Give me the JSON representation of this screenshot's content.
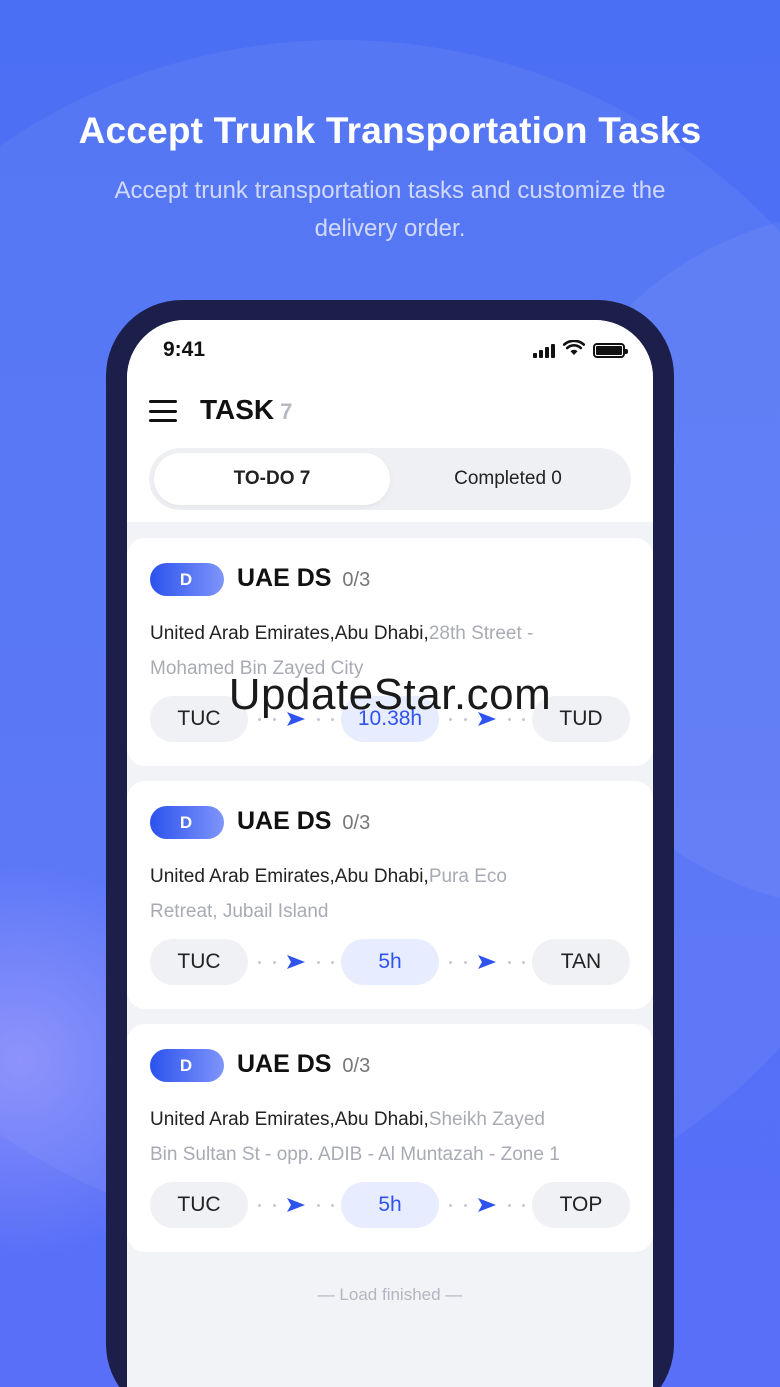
{
  "promo": {
    "headline": "Accept Trunk Transportation Tasks",
    "subline": "Accept trunk transportation tasks and customize the delivery order."
  },
  "status_bar": {
    "time": "9:41"
  },
  "header": {
    "title": "TASK",
    "count": "7"
  },
  "tabs": [
    {
      "label": "TO-DO 7",
      "active": true
    },
    {
      "label": "Completed 0",
      "active": false
    }
  ],
  "tasks": [
    {
      "badge": "D",
      "title": "UAE DS",
      "progress": "0/3",
      "address_main": "United Arab Emirates,Abu Dhabi,",
      "address_detail": "28th Street - Mohamed Bin Zayed City",
      "from": "TUC",
      "duration": "10.38h",
      "to": "TUD"
    },
    {
      "badge": "D",
      "title": "UAE DS",
      "progress": "0/3",
      "address_main": "United Arab Emirates,Abu Dhabi,",
      "address_detail": "Pura Eco Retreat, Jubail Island",
      "from": "TUC",
      "duration": "5h",
      "to": "TAN"
    },
    {
      "badge": "D",
      "title": "UAE DS",
      "progress": "0/3",
      "address_main": "United Arab Emirates,Abu Dhabi,",
      "address_detail": "Sheikh Zayed Bin Sultan St - opp. ADIB - Al Muntazah - Zone 1",
      "from": "TUC",
      "duration": "5h",
      "to": "TOP"
    }
  ],
  "footer": {
    "load_text": "— Load finished —"
  },
  "watermark": "UpdateStar.com",
  "colors": {
    "accent": "#2f53ee",
    "background": "#4d72f5",
    "phone_frame": "#1b1f4a"
  },
  "icons": [
    "menu-icon",
    "signal-icon",
    "wifi-icon",
    "battery-icon",
    "arrow-right-icon"
  ]
}
